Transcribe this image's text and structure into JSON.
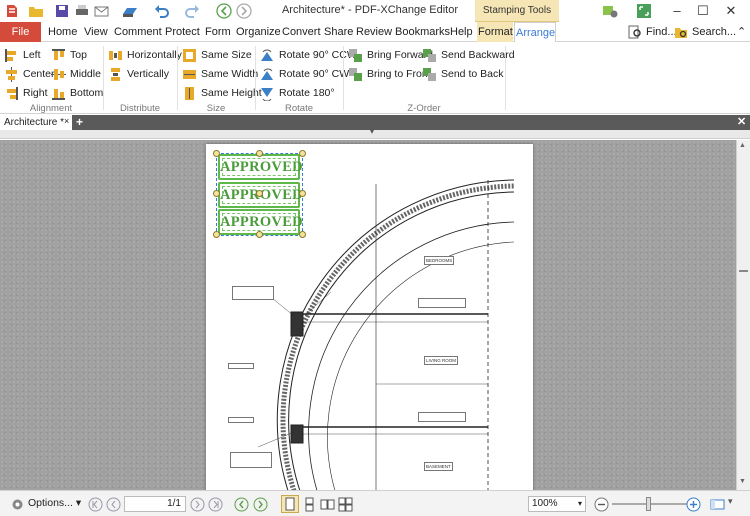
{
  "window": {
    "title": "Architecture* - PDF-XChange Editor",
    "context_tab": "Stamping Tools"
  },
  "menu": {
    "file": "File",
    "tabs": [
      "Home",
      "View",
      "Comment",
      "Protect",
      "Form",
      "Organize",
      "Convert",
      "Share",
      "Review",
      "Bookmarks",
      "Help",
      "Format",
      "Arrange"
    ],
    "find": "Find...",
    "search": "Search..."
  },
  "ribbon": {
    "alignment": {
      "label": "Alignment",
      "left": "Left",
      "center": "Center",
      "right": "Right",
      "top": "Top",
      "middle": "Middle",
      "bottom": "Bottom"
    },
    "distribute": {
      "label": "Distribute",
      "horizontally": "Horizontally",
      "vertically": "Vertically"
    },
    "size": {
      "label": "Size",
      "same_size": "Same Size",
      "same_width": "Same Width",
      "same_height": "Same Height"
    },
    "rotate": {
      "label": "Rotate",
      "cw": "Rotate 90° CCW",
      "ccw": "Rotate 90° CW",
      "r180": "Rotate 180°"
    },
    "zorder": {
      "label": "Z-Order",
      "bring_forward": "Bring Forward",
      "bring_front": "Bring to Front",
      "send_backward": "Send Backward",
      "send_back": "Send to Back"
    }
  },
  "doc_tab": {
    "name": "Architecture *"
  },
  "page": {
    "stamps": [
      "APPROVED",
      "APPROVED",
      "APPROVED"
    ],
    "rooms": [
      "BEDROOMS",
      "LIVING ROOM",
      "BASEMENT"
    ]
  },
  "status": {
    "options": "Options...",
    "page_value": "1/1",
    "zoom": "100%"
  },
  "colors": {
    "file_tab": "#d44a3b",
    "stamp_green": "#4a9b3a",
    "context_tab": "#f6e6b6"
  }
}
